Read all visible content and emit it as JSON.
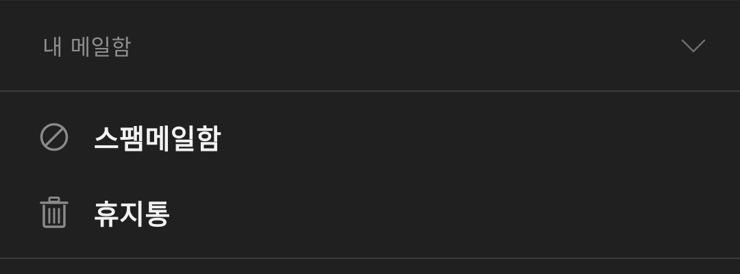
{
  "section": {
    "title": "내 메일함",
    "toggle_icon": "chevron-down-icon"
  },
  "items": [
    {
      "label": "스팸메일함",
      "icon": "block-icon"
    },
    {
      "label": "휴지통",
      "icon": "trash-icon"
    }
  ],
  "colors": {
    "background": "#202020",
    "divider": "#3d3d3d",
    "header_text": "#8e8e8e",
    "item_text": "#f2f2f2",
    "icon": "#8a8a8a"
  }
}
